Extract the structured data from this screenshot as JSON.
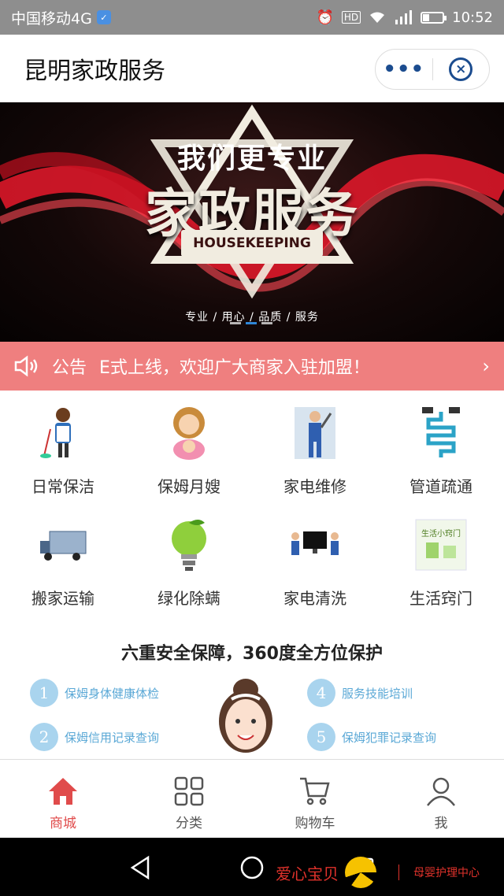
{
  "status": {
    "carrier": "中国移动4G",
    "time": "10:52",
    "net": "4G"
  },
  "title": "昆明家政服务",
  "banner": {
    "top": "我们更专业",
    "main": "家政服务",
    "en": "HOUSEKEEPING",
    "tags": "专业 / 用心 / 品质 / 服务"
  },
  "notice": {
    "label": "公告",
    "text": "E式上线，欢迎广大商家入驻加盟！"
  },
  "categories": [
    "日常保洁",
    "保姆月嫂",
    "家电维修",
    "管道疏通",
    "搬家运输",
    "绿化除螨",
    "家电清洗",
    "生活窍门"
  ],
  "safety": {
    "title": "六重安全保障，360度全方位保护",
    "items": [
      {
        "n": "1",
        "text": "保姆身体健康体检"
      },
      {
        "n": "2",
        "text": "保姆信用记录查询"
      },
      {
        "n": "4",
        "text": "服务技能培训"
      },
      {
        "n": "5",
        "text": "保姆犯罪记录查询"
      }
    ]
  },
  "tabs": [
    "商城",
    "分类",
    "购物车",
    "我"
  ],
  "watermark": {
    "left": "爱心宝贝",
    "right": "母婴护理中心"
  },
  "colors": {
    "accent": "#e04b4b",
    "notice": "#ef7f7f",
    "capsule": "#1b4c8f"
  }
}
